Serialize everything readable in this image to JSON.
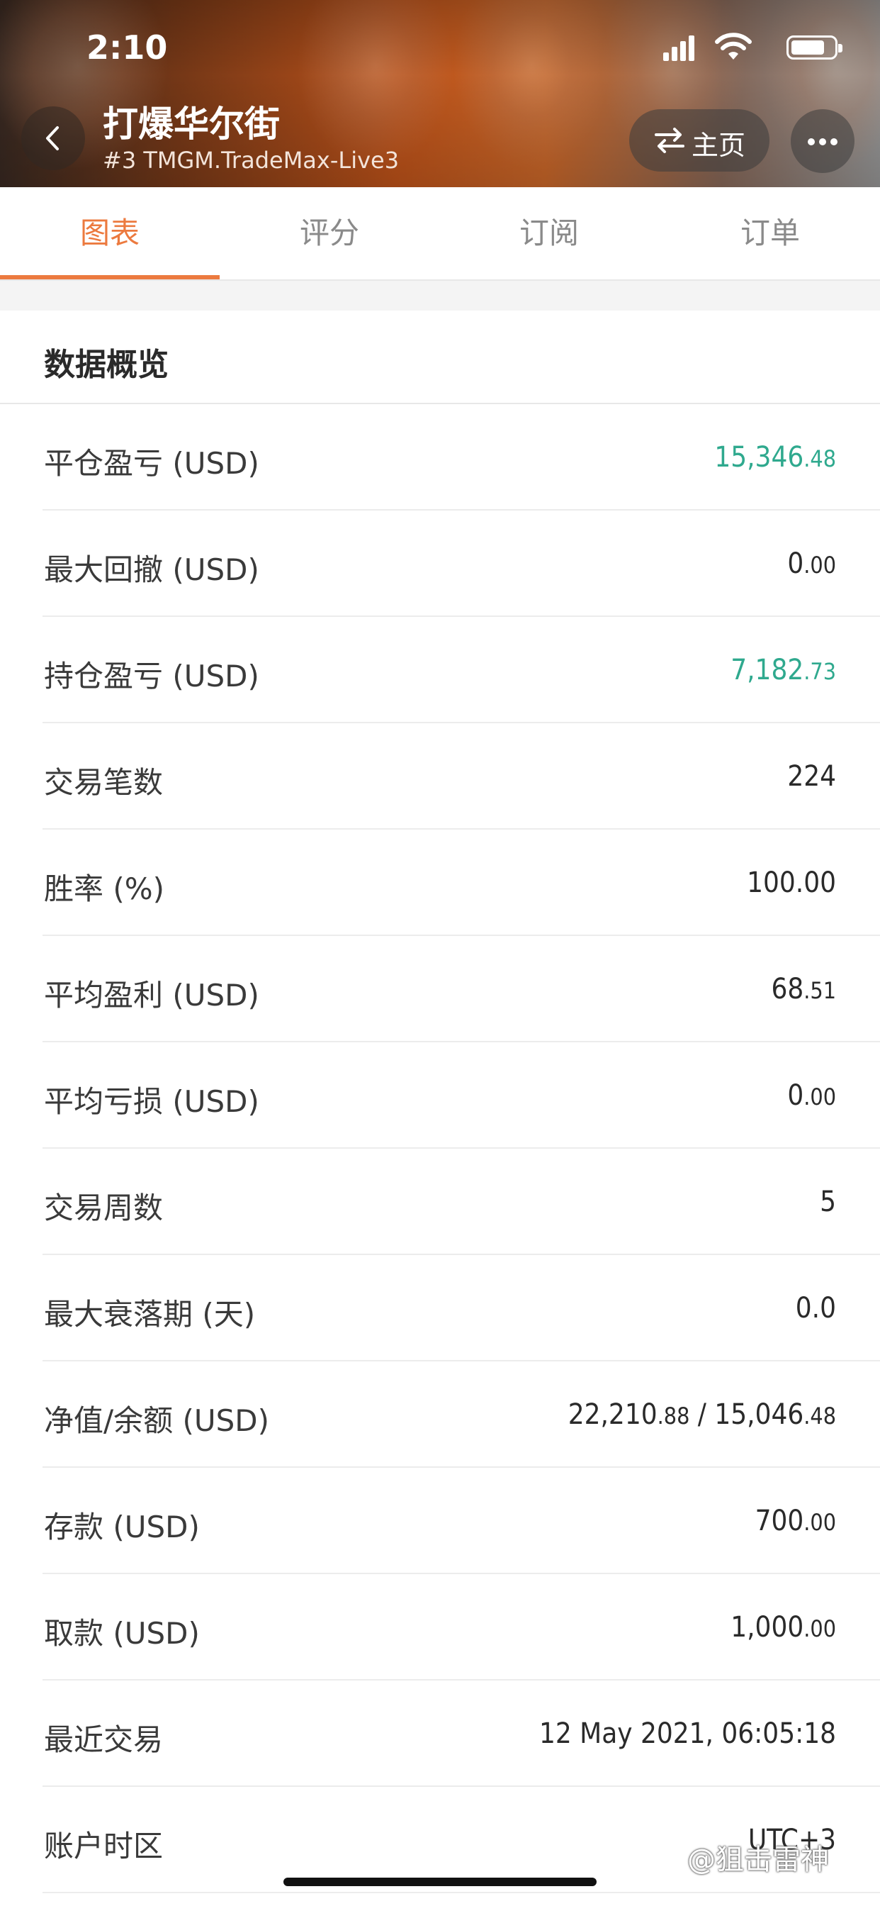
{
  "status_bar": {
    "time": "2:10"
  },
  "header": {
    "title": "打爆华尔街",
    "subtitle": "#3 TMGM.TradeMax-Live3",
    "home_label": "主页"
  },
  "tabs": [
    {
      "label": "图表",
      "active": true
    },
    {
      "label": "评分",
      "active": false
    },
    {
      "label": "订阅",
      "active": false
    },
    {
      "label": "订单",
      "active": false
    }
  ],
  "section": {
    "title": "数据概览"
  },
  "rows": [
    {
      "label": "平仓盈亏 (USD)",
      "int": "15,346",
      "dec": ".48",
      "color": "green"
    },
    {
      "label": "最大回撤 (USD)",
      "int": "0",
      "dec": ".00",
      "color": "default"
    },
    {
      "label": "持仓盈亏 (USD)",
      "int": "7,182",
      "dec": ".73",
      "color": "green"
    },
    {
      "label": "交易笔数",
      "int": "224",
      "dec": "",
      "color": "default"
    },
    {
      "label": "胜率 (%)",
      "int": "100.00",
      "dec": "",
      "color": "default"
    },
    {
      "label": "平均盈利 (USD)",
      "int": "68",
      "dec": ".51",
      "color": "default"
    },
    {
      "label": "平均亏损 (USD)",
      "int": "0",
      "dec": ".00",
      "color": "default"
    },
    {
      "label": "交易周数",
      "int": "5",
      "dec": "",
      "color": "default"
    },
    {
      "label": "最大衰落期 (天)",
      "int": "0.0",
      "dec": "",
      "color": "default"
    },
    {
      "label": "净值/余额 (USD)",
      "int": "22,210",
      "dec": ".88",
      "int2": " / 15,046",
      "dec2": ".48",
      "color": "default"
    },
    {
      "label": "存款 (USD)",
      "int": "700",
      "dec": ".00",
      "color": "default"
    },
    {
      "label": "取款 (USD)",
      "int": "1,000",
      "dec": ".00",
      "color": "default"
    },
    {
      "label": "最近交易",
      "int": "12 May 2021, 06:05:18",
      "dec": "",
      "color": "default"
    },
    {
      "label": "账户时区",
      "int": "UTC+3",
      "dec": "",
      "color": "default"
    }
  ],
  "watermark": "@狙击雷神",
  "colors": {
    "accent": "#ec7a3f",
    "positive": "#2fa98e"
  }
}
